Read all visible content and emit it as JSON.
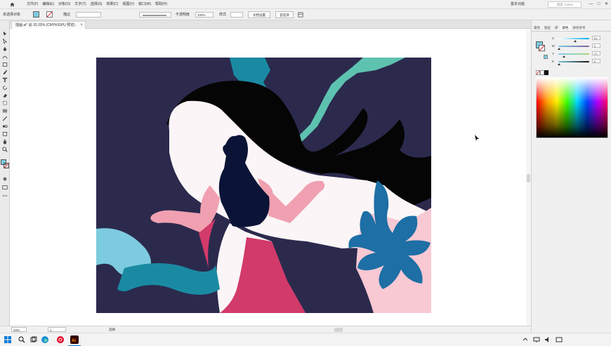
{
  "menubar": {
    "items": [
      "文件(F)",
      "编辑(E)",
      "对象(O)",
      "文字(T)",
      "选择(S)",
      "效果(C)",
      "视图(V)",
      "窗口(W)",
      "帮助(H)"
    ],
    "workspace": "基本功能",
    "search_placeholder": "搜索 Adobe Stock",
    "window_min": "—",
    "window_max": "□",
    "window_close": "✕"
  },
  "controlbar": {
    "selection_label": "未选择对象",
    "stroke_label": "描边",
    "opacity_label": "不透明度",
    "opacity_value": "100%",
    "style_label": "样式",
    "doc_setup_button": "文档设置",
    "preferences_button": "首选项"
  },
  "document": {
    "tab_title": "插画.ai* @ 33.33% (CMYK/GPU 预览)",
    "close_glyph": "×"
  },
  "statusbar": {
    "zoom": "33%",
    "artboard": "1",
    "tool_name": "选择"
  },
  "panel": {
    "tabs": [
      "属性",
      "图层",
      "库",
      "颜色",
      "颜色参考"
    ],
    "active_tab": "颜色",
    "channels": [
      {
        "label": "C",
        "value": "51"
      },
      {
        "label": "M",
        "value": "0"
      },
      {
        "label": "Y",
        "value": "17"
      },
      {
        "label": "K",
        "value": "0"
      }
    ]
  },
  "colors": {
    "background_navy": "#2b2a4d",
    "teal": "#1a8aa3",
    "mint": "#5ec2b0",
    "hair_black": "#050505",
    "skin_pink": "#f0a0b0",
    "robe_white": "#fbf5f7",
    "skirt_crimson": "#d23a6a",
    "flower_blue": "#1d6fa5",
    "flower_pink": "#f8c8d3",
    "fill_swatch": "#7dcbe0"
  },
  "taskbar": {
    "time": "",
    "date": ""
  }
}
